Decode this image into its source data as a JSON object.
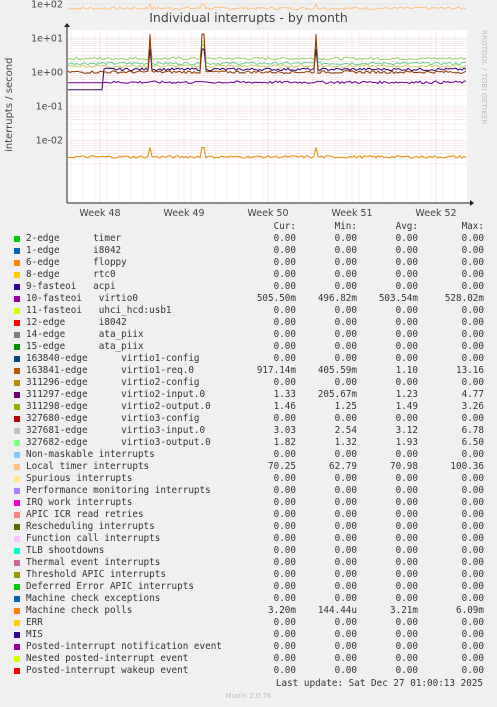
{
  "title": "Individual interrupts - by month",
  "side_label": "RRDTOOL / TOBI OETIKER",
  "ylabel": "interrupts / second",
  "footer": "Munin 2.0.76",
  "last_update": "Last update: Sat Dec 27 01:00:13 2025",
  "headers": {
    "cur": "Cur:",
    "min": "Min:",
    "avg": "Avg:",
    "max": "Max:"
  },
  "chart_data": {
    "type": "line",
    "title": "Individual interrupts - by month",
    "ylabel": "interrupts / second",
    "yscale": "log",
    "ylim": [
      0.004,
      200
    ],
    "yticks": [
      "1e+02",
      "1e+01",
      "1e+00",
      "1e-01",
      "1e-02"
    ],
    "xticks": [
      "Week 48",
      "Week 49",
      "Week 50",
      "Week 51",
      "Week 52"
    ],
    "grid": true,
    "series": [
      {
        "name": "Local timer interrupts",
        "color": "#ffbf80",
        "level": 75,
        "spike_level": 100
      },
      {
        "name": "311298-edge virtio2-output.0",
        "color": "#99cc66",
        "level": 2.5,
        "spike_level": 8
      },
      {
        "name": "327682-edge virtio3-output.0",
        "color": "#66cc99",
        "level": 1.8,
        "spike_level": 6
      },
      {
        "name": "327681-edge virtio3-input.0",
        "color": "#cccc66",
        "level": 1.5,
        "spike_level": 6.5
      },
      {
        "name": "311297-edge virtio2-input.0",
        "color": "#330066",
        "level": 1.2,
        "spike_level": 4.7
      },
      {
        "name": "163841-edge virtio1-req.0",
        "color": "#8c3800",
        "level": 1.0,
        "spike_level": 13
      },
      {
        "name": "10-fasteoi virtio0",
        "color": "#660099",
        "level": 0.5,
        "spike_level": 0.52
      },
      {
        "name": "Machine check polls",
        "color": "#e68a00",
        "level": 0.0032,
        "spike_level": 0.006
      }
    ],
    "legend": [
      {
        "label": "2-edge      timer",
        "color": "#00cc00",
        "cur": "0.00",
        "min": "0.00",
        "avg": "0.00",
        "max": "0.00"
      },
      {
        "label": "1-edge      i8042",
        "color": "#0066b3",
        "cur": "0.00",
        "min": "0.00",
        "avg": "0.00",
        "max": "0.00"
      },
      {
        "label": "6-edge      floppy",
        "color": "#ff8000",
        "cur": "0.00",
        "min": "0.00",
        "avg": "0.00",
        "max": "0.00"
      },
      {
        "label": "8-edge      rtc0",
        "color": "#ffcc00",
        "cur": "0.00",
        "min": "0.00",
        "avg": "0.00",
        "max": "0.00"
      },
      {
        "label": "9-fasteoi   acpi",
        "color": "#330099",
        "cur": "0.00",
        "min": "0.00",
        "avg": "0.00",
        "max": "0.00"
      },
      {
        "label": "10-fasteoi   virtio0",
        "color": "#990099",
        "cur": "505.50m",
        "min": "496.82m",
        "avg": "503.54m",
        "max": "528.02m"
      },
      {
        "label": "11-fasteoi   uhci_hcd:usb1",
        "color": "#ccff00",
        "cur": "0.00",
        "min": "0.00",
        "avg": "0.00",
        "max": "0.00"
      },
      {
        "label": "12-edge      i8042",
        "color": "#ff0000",
        "cur": "0.00",
        "min": "0.00",
        "avg": "0.00",
        "max": "0.00"
      },
      {
        "label": "14-edge      ata_piix",
        "color": "#808080",
        "cur": "0.00",
        "min": "0.00",
        "avg": "0.00",
        "max": "0.00"
      },
      {
        "label": "15-edge      ata_piix",
        "color": "#008f00",
        "cur": "0.00",
        "min": "0.00",
        "avg": "0.00",
        "max": "0.00"
      },
      {
        "label": "163840-edge      virtio1-config",
        "color": "#00487d",
        "cur": "0.00",
        "min": "0.00",
        "avg": "0.00",
        "max": "0.00"
      },
      {
        "label": "163841-edge      virtio1-req.0",
        "color": "#b35a00",
        "cur": "917.14m",
        "min": "405.59m",
        "avg": "1.10",
        "max": "13.16"
      },
      {
        "label": "311296-edge      virtio2-config",
        "color": "#b38f00",
        "cur": "0.00",
        "min": "0.00",
        "avg": "0.00",
        "max": "0.00"
      },
      {
        "label": "311297-edge      virtio2-input.0",
        "color": "#6b006b",
        "cur": "1.33",
        "min": "205.67m",
        "avg": "1.23",
        "max": "4.77"
      },
      {
        "label": "311298-edge      virtio2-output.0",
        "color": "#8fb300",
        "cur": "1.46",
        "min": "1.25",
        "avg": "1.49",
        "max": "3.26"
      },
      {
        "label": "327680-edge      virtio3-config",
        "color": "#b30000",
        "cur": "0.00",
        "min": "0.00",
        "avg": "0.00",
        "max": "0.00"
      },
      {
        "label": "327681-edge      virtio3-input.0",
        "color": "#bebebe",
        "cur": "3.03",
        "min": "2.54",
        "avg": "3.12",
        "max": "6.78"
      },
      {
        "label": "327682-edge      virtio3-output.0",
        "color": "#80ff80",
        "cur": "1.82",
        "min": "1.32",
        "avg": "1.93",
        "max": "6.50"
      },
      {
        "label": "Non-maskable interrupts",
        "color": "#80c9ff",
        "cur": "0.00",
        "min": "0.00",
        "avg": "0.00",
        "max": "0.00"
      },
      {
        "label": "Local timer interrupts",
        "color": "#ffc080",
        "cur": "70.25",
        "min": "62.79",
        "avg": "70.98",
        "max": "100.36"
      },
      {
        "label": "Spurious interrupts",
        "color": "#ffe680",
        "cur": "0.00",
        "min": "0.00",
        "avg": "0.00",
        "max": "0.00"
      },
      {
        "label": "Performance monitoring interrupts",
        "color": "#aa80ff",
        "cur": "0.00",
        "min": "0.00",
        "avg": "0.00",
        "max": "0.00"
      },
      {
        "label": "IRQ work interrupts",
        "color": "#ee00cc",
        "cur": "0.00",
        "min": "0.00",
        "avg": "0.00",
        "max": "0.00"
      },
      {
        "label": "APIC ICR read retries",
        "color": "#ff8080",
        "cur": "0.00",
        "min": "0.00",
        "avg": "0.00",
        "max": "0.00"
      },
      {
        "label": "Rescheduling interrupts",
        "color": "#666600",
        "cur": "0.00",
        "min": "0.00",
        "avg": "0.00",
        "max": "0.00"
      },
      {
        "label": "Function call interrupts",
        "color": "#ffbfff",
        "cur": "0.00",
        "min": "0.00",
        "avg": "0.00",
        "max": "0.00"
      },
      {
        "label": "TLB shootdowns",
        "color": "#00ffcc",
        "cur": "0.00",
        "min": "0.00",
        "avg": "0.00",
        "max": "0.00"
      },
      {
        "label": "Thermal event interrupts",
        "color": "#cc6699",
        "cur": "0.00",
        "min": "0.00",
        "avg": "0.00",
        "max": "0.00"
      },
      {
        "label": "Threshold APIC interrupts",
        "color": "#999900",
        "cur": "0.00",
        "min": "0.00",
        "avg": "0.00",
        "max": "0.00"
      },
      {
        "label": "Deferred Error APIC interrupts",
        "color": "#00cc00",
        "cur": "0.00",
        "min": "0.00",
        "avg": "0.00",
        "max": "0.00"
      },
      {
        "label": "Machine check exceptions",
        "color": "#0066b3",
        "cur": "0.00",
        "min": "0.00",
        "avg": "0.00",
        "max": "0.00"
      },
      {
        "label": "Machine check polls",
        "color": "#ff8000",
        "cur": "3.20m",
        "min": "144.44u",
        "avg": "3.21m",
        "max": "6.09m"
      },
      {
        "label": "ERR",
        "color": "#ffcc00",
        "cur": "0.00",
        "min": "0.00",
        "avg": "0.00",
        "max": "0.00"
      },
      {
        "label": "MIS",
        "color": "#330099",
        "cur": "0.00",
        "min": "0.00",
        "avg": "0.00",
        "max": "0.00"
      },
      {
        "label": "Posted-interrupt notification event",
        "color": "#990099",
        "cur": "0.00",
        "min": "0.00",
        "avg": "0.00",
        "max": "0.00"
      },
      {
        "label": "Nested posted-interrupt event",
        "color": "#ccff00",
        "cur": "0.00",
        "min": "0.00",
        "avg": "0.00",
        "max": "0.00"
      },
      {
        "label": "Posted-interrupt wakeup event",
        "color": "#ff0000",
        "cur": "0.00",
        "min": "0.00",
        "avg": "0.00",
        "max": "0.00"
      }
    ]
  }
}
